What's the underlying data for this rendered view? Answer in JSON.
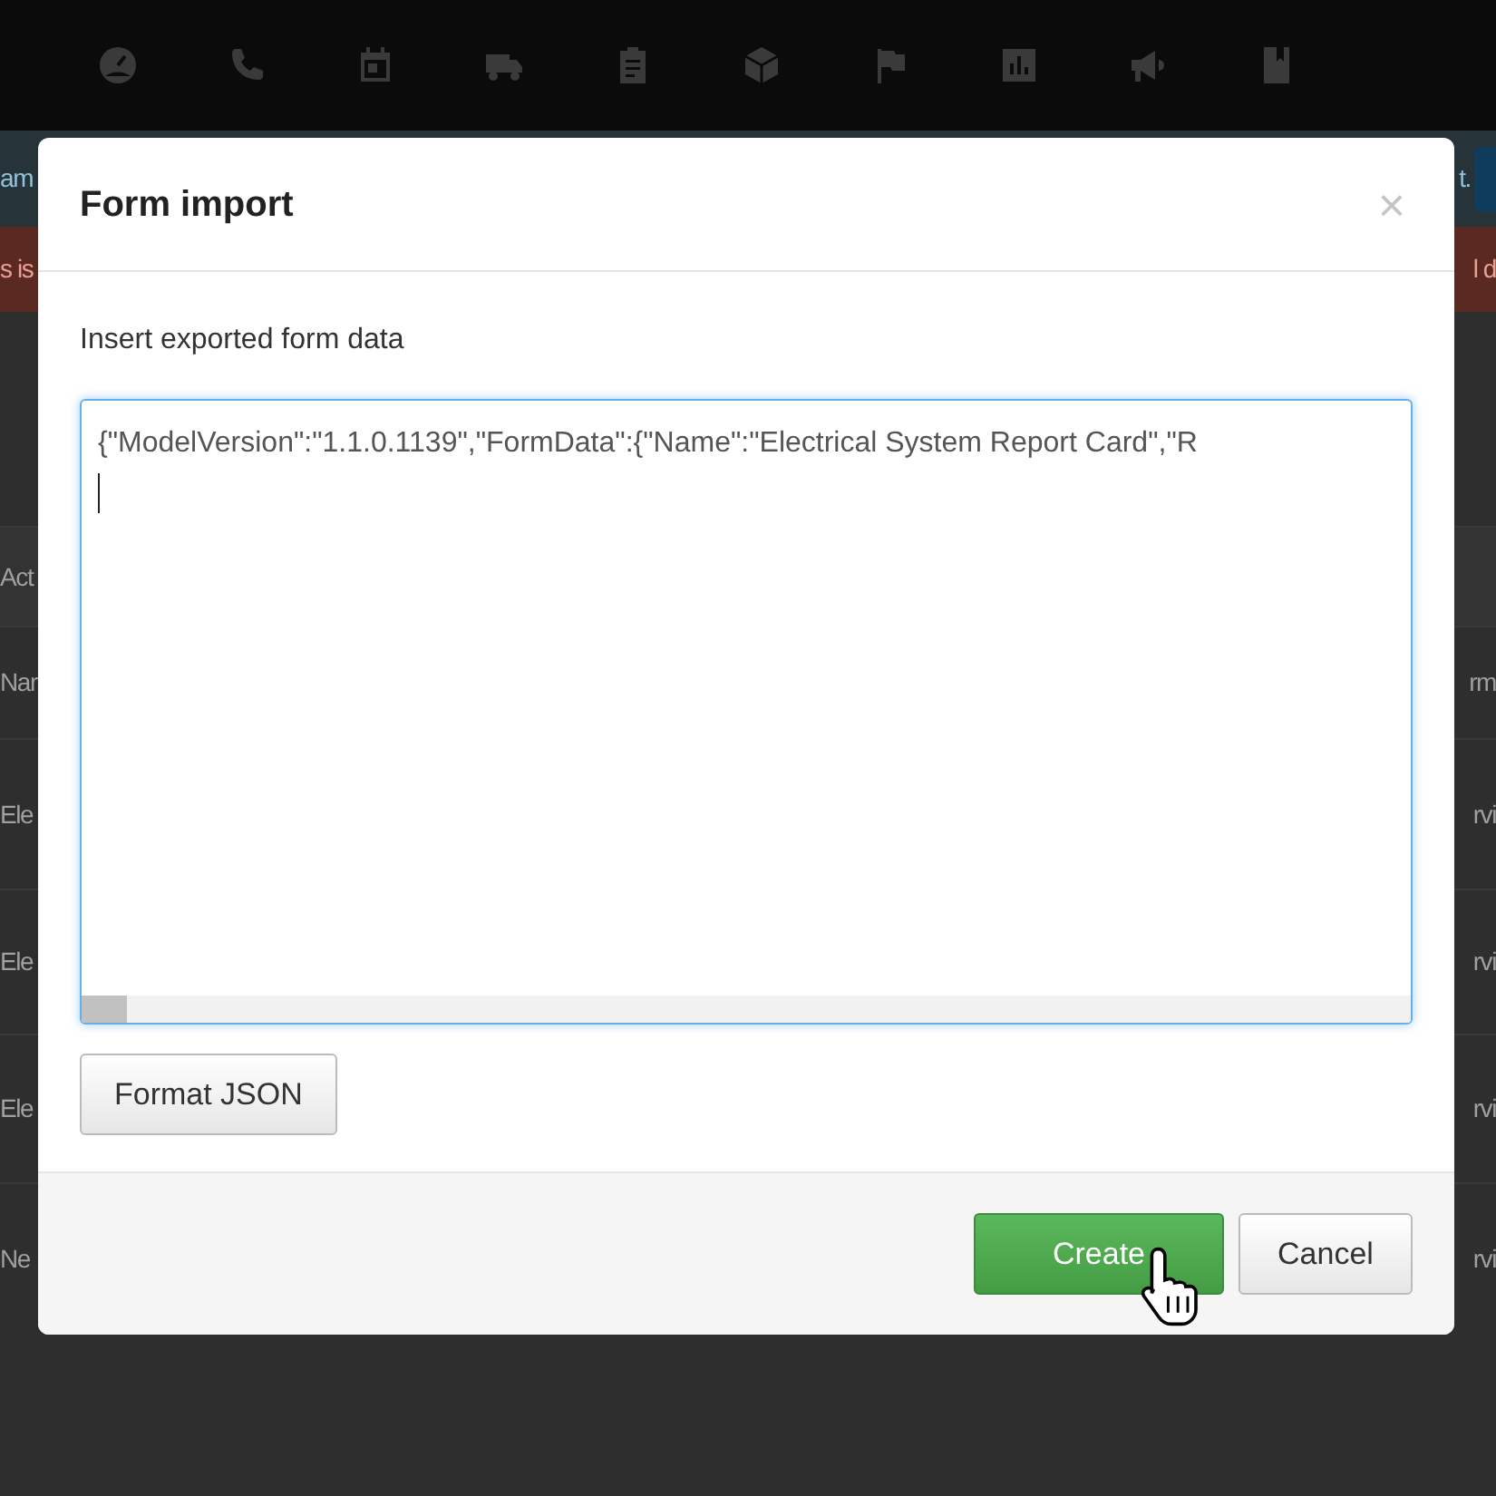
{
  "background": {
    "info_strip": {
      "left": "am",
      "right": "t."
    },
    "alert_strip": {
      "left": "s is",
      "right": "l d"
    },
    "rows": [
      {
        "left": "Act",
        "right": ""
      },
      {
        "left": "Nar",
        "right": "rm"
      },
      {
        "left": "Ele",
        "right": "rvi"
      },
      {
        "left": "Ele",
        "right": "rvi"
      },
      {
        "left": "Ele",
        "right": "rvi"
      },
      {
        "left": "Ne",
        "right": "rvi"
      }
    ]
  },
  "dialog": {
    "title": "Form import",
    "close": "×",
    "label": "Insert exported form data",
    "value": "{\"ModelVersion\":\"1.1.0.1139\",\"FormData\":{\"Name\":\"Electrical System Report Card\",\"R",
    "format_button": "Format JSON",
    "buttons": [
      {
        "label": "Create",
        "kind": "primary"
      },
      {
        "label": "Cancel",
        "kind": "default"
      }
    ]
  }
}
